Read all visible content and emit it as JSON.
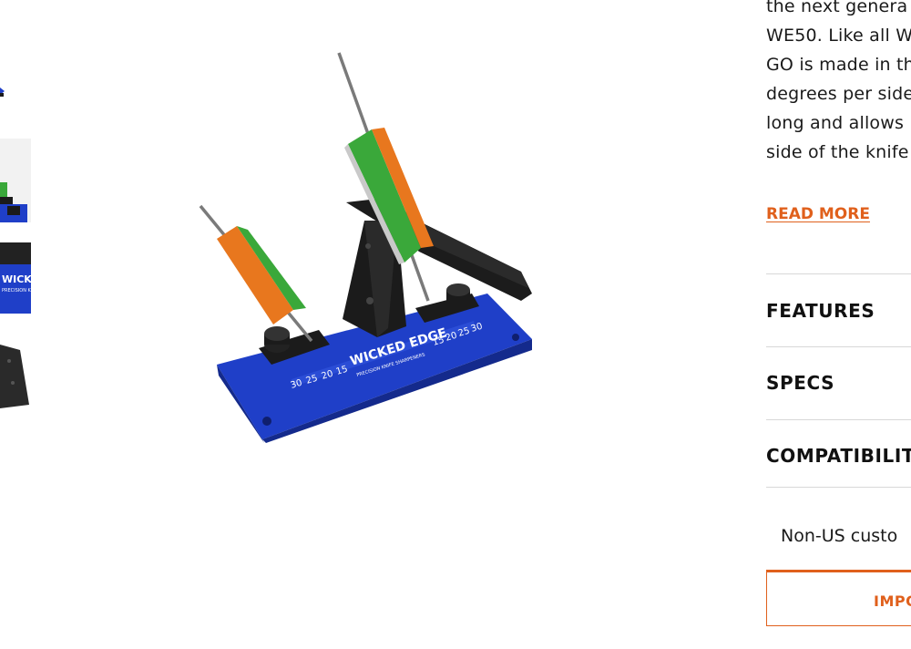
{
  "thumbnails": [
    {
      "name": "thumbnail-1"
    },
    {
      "name": "thumbnail-2"
    },
    {
      "name": "thumbnail-3"
    },
    {
      "name": "thumbnail-4"
    }
  ],
  "product_image": {
    "base_text_brand": "WICKED EDGE",
    "base_text_sub": "PRECISION KNIFE SHARPENERS",
    "scale_left": [
      "30",
      "25",
      "20",
      "15"
    ],
    "scale_right": [
      "15",
      "20",
      "25",
      "30"
    ],
    "colors": {
      "base": "#1f3fc8",
      "stone_green": "#3aa83a",
      "stone_orange": "#e8771e",
      "clamp": "#1b1b1b"
    }
  },
  "description": {
    "lines": [
      "the next genera",
      "WE50. Like all W",
      "GO is made in th",
      "degrees per side",
      "long and allows",
      "side of the knife"
    ],
    "read_more": "READ MORE"
  },
  "accordion": [
    {
      "title": "FEATURES"
    },
    {
      "title": "SPECS"
    },
    {
      "title": "COMPATIBILIT"
    }
  ],
  "notice": "Non-US custo",
  "import_button": "IMPO",
  "accent": "#e0601c"
}
